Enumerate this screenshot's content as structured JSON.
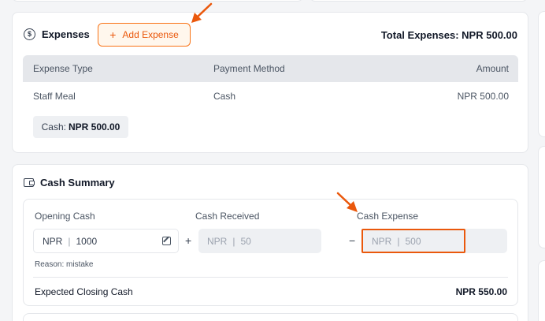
{
  "expenses": {
    "title": "Expenses",
    "add_button_label": "Add Expense",
    "total_label": "Total Expenses: NPR 500.00",
    "table": {
      "headers": [
        "Expense Type",
        "Payment Method",
        "Amount"
      ],
      "rows": [
        {
          "type": "Staff Meal",
          "method": "Cash",
          "amount": "NPR 500.00"
        }
      ]
    },
    "summary_chip": {
      "label": "Cash:",
      "value": "NPR 500.00"
    }
  },
  "cash_summary": {
    "title": "Cash Summary",
    "opening_cash": {
      "label": "Opening Cash",
      "currency": "NPR",
      "separator": "|",
      "value": "1000"
    },
    "plus_symbol": "+",
    "cash_received": {
      "label": "Cash Received",
      "currency": "NPR",
      "separator": "|",
      "value": "50"
    },
    "minus_symbol": "−",
    "cash_expense": {
      "label": "Cash Expense",
      "currency": "NPR",
      "separator": "|",
      "value": "500"
    },
    "reason": "Reason: mistake",
    "expected_closing": {
      "label": "Expected Closing Cash",
      "value": "NPR 550.00"
    }
  },
  "colors": {
    "accent": "#ea580c",
    "highlight_border": "#ea580c",
    "annotation_arrow": "#ea580c"
  },
  "icons": [
    "dollar-circle-icon",
    "plus-icon",
    "wallet-icon",
    "edit-icon"
  ]
}
